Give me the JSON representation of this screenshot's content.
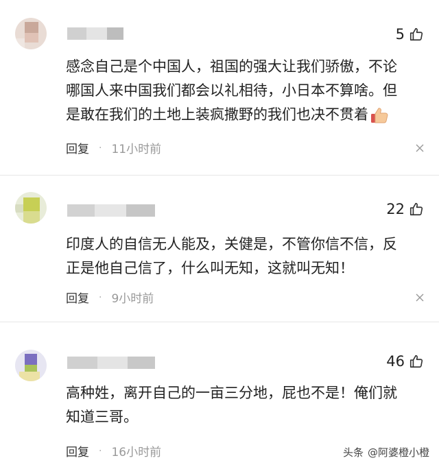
{
  "comments": [
    {
      "likes": "5",
      "lines": [
        "感念自己是个中国人，祖国的强大让我们骄傲，不论",
        "哪国人来中国我们都会以礼相待，小日本不算啥。但",
        "是敢在我们的土地上装疯撒野的我们也决不贯着"
      ],
      "emoji": "thumbs-up-emoji",
      "reply_label": "回复",
      "dot": "·",
      "time": "11小时前"
    },
    {
      "likes": "22",
      "lines": [
        "印度人的自信无人能及，关健是，不管你信不信，反",
        "正是他自己信了，什么叫无知，这就叫无知！"
      ],
      "reply_label": "回复",
      "dot": "·",
      "time": "9小时前"
    },
    {
      "likes": "46",
      "lines": [
        "高种姓，离开自己的一亩三分地，屁也不是！俺们就",
        "知道三哥。"
      ],
      "reply_label": "回复",
      "dot": "·",
      "time": "16小时前"
    }
  ],
  "watermark": {
    "source": "头条",
    "handle": "@阿婆橙小橙"
  },
  "icons": {
    "like": "thumb-up-outline-icon",
    "more": "close-x-icon"
  }
}
